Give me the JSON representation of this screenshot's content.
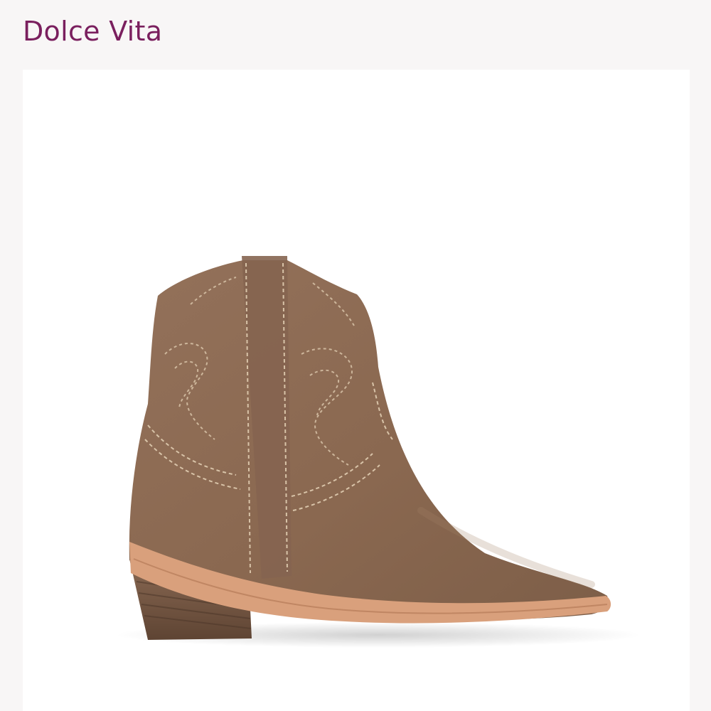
{
  "header": {
    "brand_name": "Dolce Vita",
    "brand_color": "#7a1f5e"
  },
  "product": {
    "image_icon": "ankle-boot-image",
    "colors": {
      "suede": "#8c6a52",
      "suede_dark": "#6f513e",
      "stitching": "#d8c3a8",
      "welt": "#d9a07c",
      "heel": "#7a5a45"
    }
  }
}
